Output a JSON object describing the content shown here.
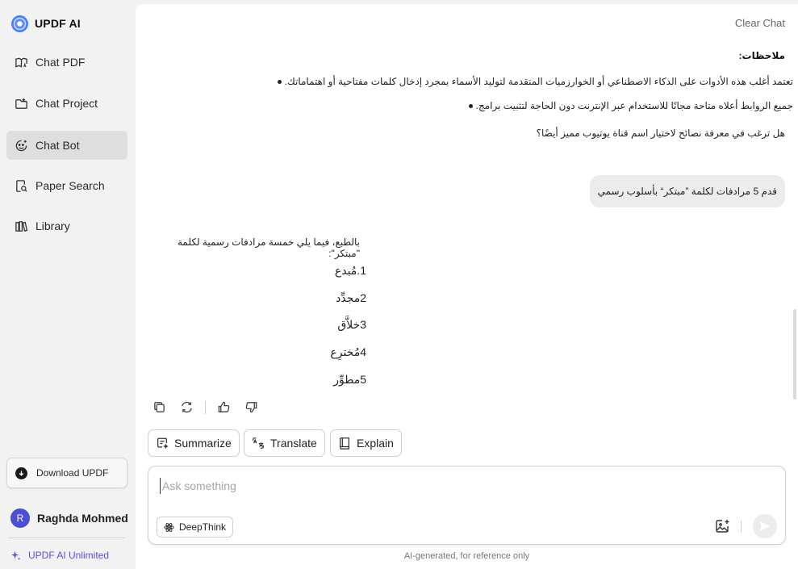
{
  "brand": {
    "name": "UPDF AI"
  },
  "nav": [
    {
      "label": "Chat PDF",
      "icon": "book-open-icon",
      "active": false
    },
    {
      "label": "Chat Project",
      "icon": "folder-icon",
      "active": false
    },
    {
      "label": "Chat Bot",
      "icon": "bot-face-icon",
      "active": true
    },
    {
      "label": "Paper Search",
      "icon": "paper-search-icon",
      "active": false
    },
    {
      "label": "Library",
      "icon": "library-icon",
      "active": false
    }
  ],
  "download": {
    "label": "Download UPDF"
  },
  "user": {
    "initial": "R",
    "name": "Raghda Mohmed"
  },
  "plan": {
    "label": "UPDF AI Unlimited"
  },
  "header": {
    "clear_chat": "Clear Chat"
  },
  "chat": {
    "notes_heading": "ملاحظات:",
    "notes": [
      "تعتمد أغلب هذه الأدوات على الذكاء الاصطناعي أو الخوارزميات المتقدمة لتوليد الأسماء بمجرد إدخال كلمات مفتاحية أو اهتماماتك.",
      "جميع الروابط أعلاه متاحة مجانًا للاستخدام عبر الإنترنت دون الحاجة لتثبيت برامج."
    ],
    "question": "هل ترغب في معرفة نصائح لاختيار اسم قناة يوتيوب مميز أيضًا؟",
    "user_message": "قدم 5 مرادفات لكلمة ”مبتكر“ بأسلوب رسمي",
    "answer_intro": "بالطبع، فيما يلي خمسة مرادفات رسمية لكلمة \"مبتكر\":",
    "synonyms": [
      "1.مُبدع",
      "2مجدِّد",
      "3خلاَّق",
      "4مُخترِع",
      "5مطوِّر"
    ]
  },
  "actions": {
    "summarize": "Summarize",
    "translate": "Translate",
    "explain": "Explain"
  },
  "input": {
    "placeholder": "Ask something",
    "deepthink": "DeepThink"
  },
  "footnote": "AI-generated, for reference only"
}
